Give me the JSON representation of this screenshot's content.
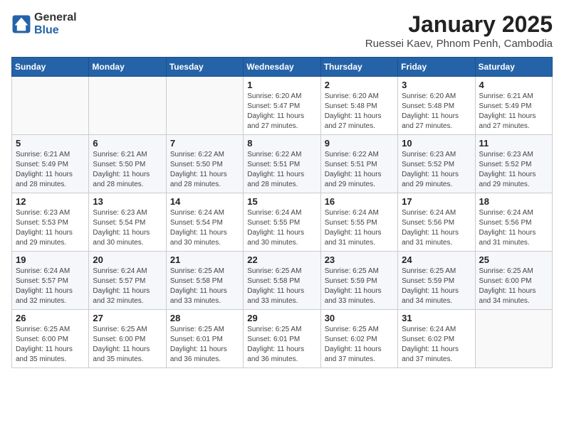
{
  "header": {
    "logo_general": "General",
    "logo_blue": "Blue",
    "month_title": "January 2025",
    "location": "Ruessei Kaev, Phnom Penh, Cambodia"
  },
  "weekdays": [
    "Sunday",
    "Monday",
    "Tuesday",
    "Wednesday",
    "Thursday",
    "Friday",
    "Saturday"
  ],
  "weeks": [
    [
      {
        "day": "",
        "sunrise": "",
        "sunset": "",
        "daylight": ""
      },
      {
        "day": "",
        "sunrise": "",
        "sunset": "",
        "daylight": ""
      },
      {
        "day": "",
        "sunrise": "",
        "sunset": "",
        "daylight": ""
      },
      {
        "day": "1",
        "sunrise": "Sunrise: 6:20 AM",
        "sunset": "Sunset: 5:47 PM",
        "daylight": "Daylight: 11 hours and 27 minutes."
      },
      {
        "day": "2",
        "sunrise": "Sunrise: 6:20 AM",
        "sunset": "Sunset: 5:48 PM",
        "daylight": "Daylight: 11 hours and 27 minutes."
      },
      {
        "day": "3",
        "sunrise": "Sunrise: 6:20 AM",
        "sunset": "Sunset: 5:48 PM",
        "daylight": "Daylight: 11 hours and 27 minutes."
      },
      {
        "day": "4",
        "sunrise": "Sunrise: 6:21 AM",
        "sunset": "Sunset: 5:49 PM",
        "daylight": "Daylight: 11 hours and 27 minutes."
      }
    ],
    [
      {
        "day": "5",
        "sunrise": "Sunrise: 6:21 AM",
        "sunset": "Sunset: 5:49 PM",
        "daylight": "Daylight: 11 hours and 28 minutes."
      },
      {
        "day": "6",
        "sunrise": "Sunrise: 6:21 AM",
        "sunset": "Sunset: 5:50 PM",
        "daylight": "Daylight: 11 hours and 28 minutes."
      },
      {
        "day": "7",
        "sunrise": "Sunrise: 6:22 AM",
        "sunset": "Sunset: 5:50 PM",
        "daylight": "Daylight: 11 hours and 28 minutes."
      },
      {
        "day": "8",
        "sunrise": "Sunrise: 6:22 AM",
        "sunset": "Sunset: 5:51 PM",
        "daylight": "Daylight: 11 hours and 28 minutes."
      },
      {
        "day": "9",
        "sunrise": "Sunrise: 6:22 AM",
        "sunset": "Sunset: 5:51 PM",
        "daylight": "Daylight: 11 hours and 29 minutes."
      },
      {
        "day": "10",
        "sunrise": "Sunrise: 6:23 AM",
        "sunset": "Sunset: 5:52 PM",
        "daylight": "Daylight: 11 hours and 29 minutes."
      },
      {
        "day": "11",
        "sunrise": "Sunrise: 6:23 AM",
        "sunset": "Sunset: 5:52 PM",
        "daylight": "Daylight: 11 hours and 29 minutes."
      }
    ],
    [
      {
        "day": "12",
        "sunrise": "Sunrise: 6:23 AM",
        "sunset": "Sunset: 5:53 PM",
        "daylight": "Daylight: 11 hours and 29 minutes."
      },
      {
        "day": "13",
        "sunrise": "Sunrise: 6:23 AM",
        "sunset": "Sunset: 5:54 PM",
        "daylight": "Daylight: 11 hours and 30 minutes."
      },
      {
        "day": "14",
        "sunrise": "Sunrise: 6:24 AM",
        "sunset": "Sunset: 5:54 PM",
        "daylight": "Daylight: 11 hours and 30 minutes."
      },
      {
        "day": "15",
        "sunrise": "Sunrise: 6:24 AM",
        "sunset": "Sunset: 5:55 PM",
        "daylight": "Daylight: 11 hours and 30 minutes."
      },
      {
        "day": "16",
        "sunrise": "Sunrise: 6:24 AM",
        "sunset": "Sunset: 5:55 PM",
        "daylight": "Daylight: 11 hours and 31 minutes."
      },
      {
        "day": "17",
        "sunrise": "Sunrise: 6:24 AM",
        "sunset": "Sunset: 5:56 PM",
        "daylight": "Daylight: 11 hours and 31 minutes."
      },
      {
        "day": "18",
        "sunrise": "Sunrise: 6:24 AM",
        "sunset": "Sunset: 5:56 PM",
        "daylight": "Daylight: 11 hours and 31 minutes."
      }
    ],
    [
      {
        "day": "19",
        "sunrise": "Sunrise: 6:24 AM",
        "sunset": "Sunset: 5:57 PM",
        "daylight": "Daylight: 11 hours and 32 minutes."
      },
      {
        "day": "20",
        "sunrise": "Sunrise: 6:24 AM",
        "sunset": "Sunset: 5:57 PM",
        "daylight": "Daylight: 11 hours and 32 minutes."
      },
      {
        "day": "21",
        "sunrise": "Sunrise: 6:25 AM",
        "sunset": "Sunset: 5:58 PM",
        "daylight": "Daylight: 11 hours and 33 minutes."
      },
      {
        "day": "22",
        "sunrise": "Sunrise: 6:25 AM",
        "sunset": "Sunset: 5:58 PM",
        "daylight": "Daylight: 11 hours and 33 minutes."
      },
      {
        "day": "23",
        "sunrise": "Sunrise: 6:25 AM",
        "sunset": "Sunset: 5:59 PM",
        "daylight": "Daylight: 11 hours and 33 minutes."
      },
      {
        "day": "24",
        "sunrise": "Sunrise: 6:25 AM",
        "sunset": "Sunset: 5:59 PM",
        "daylight": "Daylight: 11 hours and 34 minutes."
      },
      {
        "day": "25",
        "sunrise": "Sunrise: 6:25 AM",
        "sunset": "Sunset: 6:00 PM",
        "daylight": "Daylight: 11 hours and 34 minutes."
      }
    ],
    [
      {
        "day": "26",
        "sunrise": "Sunrise: 6:25 AM",
        "sunset": "Sunset: 6:00 PM",
        "daylight": "Daylight: 11 hours and 35 minutes."
      },
      {
        "day": "27",
        "sunrise": "Sunrise: 6:25 AM",
        "sunset": "Sunset: 6:00 PM",
        "daylight": "Daylight: 11 hours and 35 minutes."
      },
      {
        "day": "28",
        "sunrise": "Sunrise: 6:25 AM",
        "sunset": "Sunset: 6:01 PM",
        "daylight": "Daylight: 11 hours and 36 minutes."
      },
      {
        "day": "29",
        "sunrise": "Sunrise: 6:25 AM",
        "sunset": "Sunset: 6:01 PM",
        "daylight": "Daylight: 11 hours and 36 minutes."
      },
      {
        "day": "30",
        "sunrise": "Sunrise: 6:25 AM",
        "sunset": "Sunset: 6:02 PM",
        "daylight": "Daylight: 11 hours and 37 minutes."
      },
      {
        "day": "31",
        "sunrise": "Sunrise: 6:24 AM",
        "sunset": "Sunset: 6:02 PM",
        "daylight": "Daylight: 11 hours and 37 minutes."
      },
      {
        "day": "",
        "sunrise": "",
        "sunset": "",
        "daylight": ""
      }
    ]
  ]
}
